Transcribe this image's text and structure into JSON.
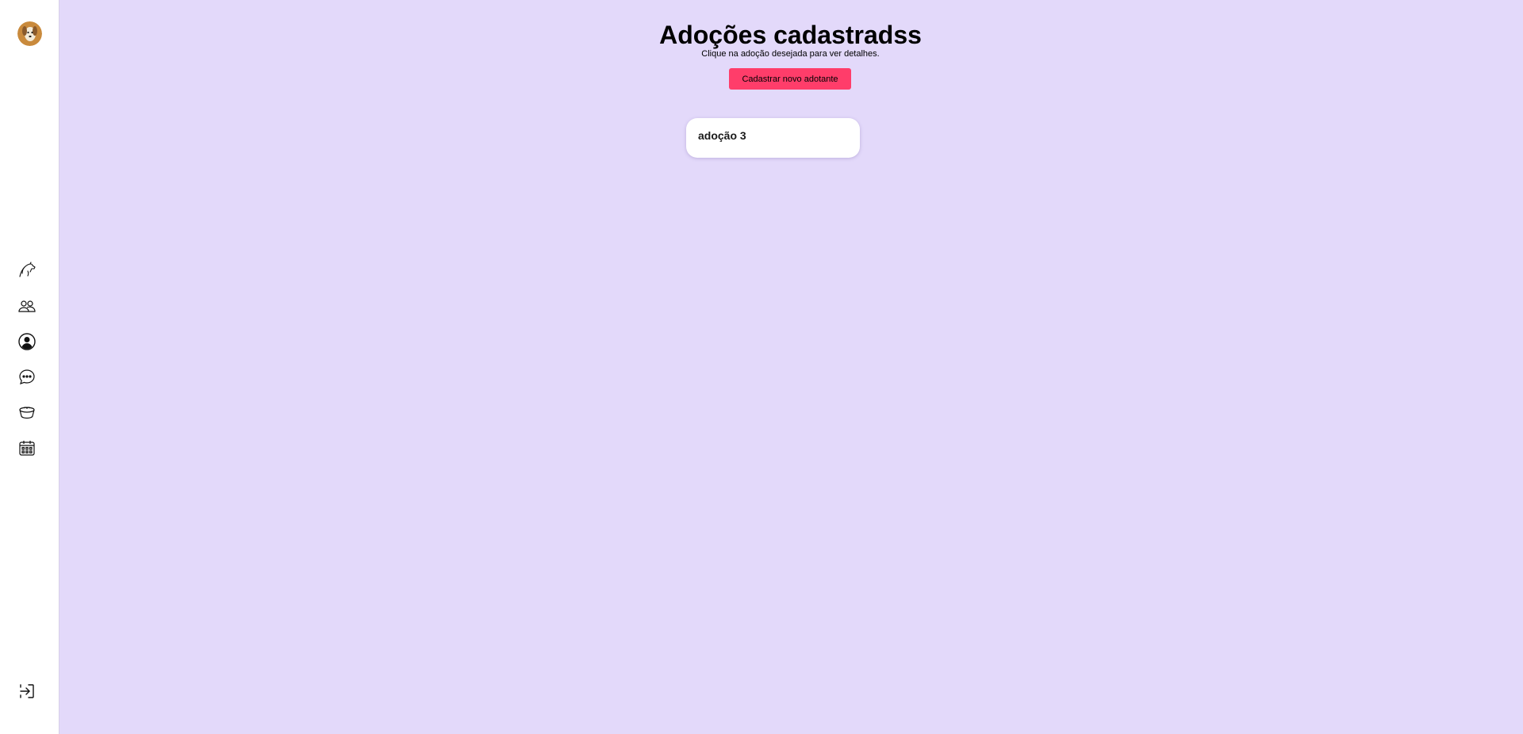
{
  "sidebar": {
    "avatar_colors": {
      "background": "#c98a3c",
      "face": "#f3ead8"
    },
    "items": [
      {
        "icon": "dog-icon"
      },
      {
        "icon": "users-icon"
      },
      {
        "icon": "profile-icon"
      },
      {
        "icon": "chat-icon"
      },
      {
        "icon": "pet-bowl-icon"
      },
      {
        "icon": "calendar-icon"
      }
    ],
    "footer_icon": "logout-icon"
  },
  "main": {
    "title": "Adoções cadastradss",
    "subtitle": "Clique na adoção desejada para ver detalhes.",
    "new_button_label": "Cadastrar novo adotante",
    "cards": [
      {
        "label": "adoção 3"
      }
    ]
  },
  "colors": {
    "background": "#e3d9fa",
    "sidebar": "#ffffff",
    "accent": "#ff3d6a"
  }
}
